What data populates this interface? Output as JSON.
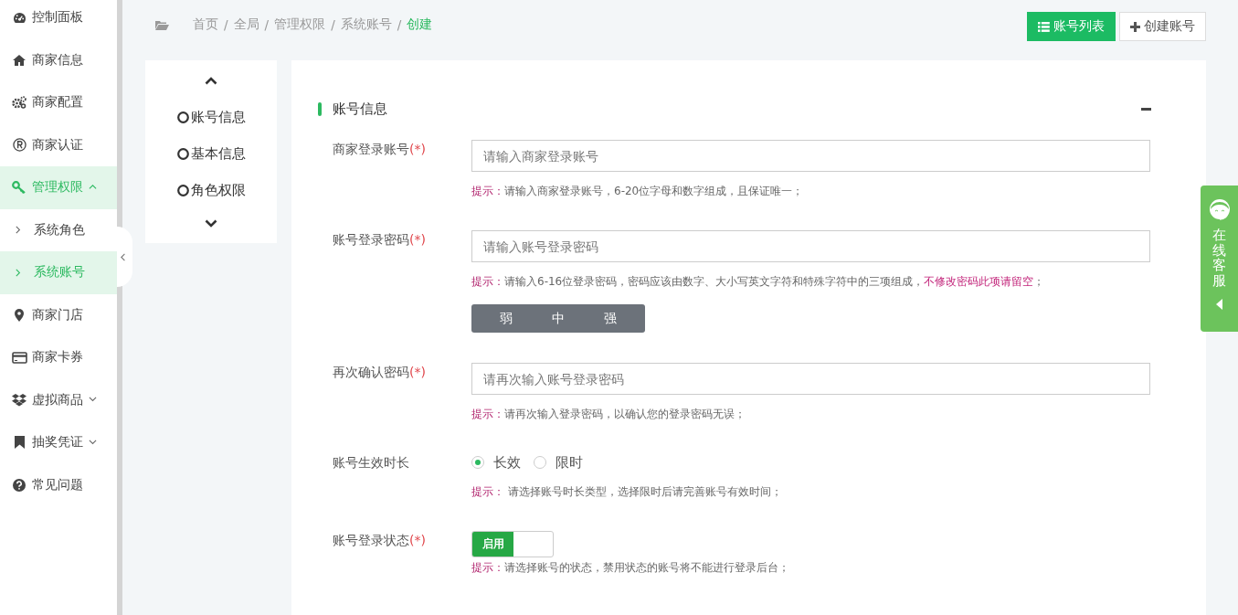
{
  "sidebar": {
    "items": [
      {
        "label": "控制面板",
        "selected": false
      },
      {
        "label": "商家信息",
        "selected": false
      },
      {
        "label": "商家配置",
        "selected": false
      },
      {
        "label": "商家认证",
        "selected": false
      },
      {
        "label": "管理权限",
        "selected": true,
        "expanded": true,
        "children": [
          {
            "label": "系统角色",
            "selected": false
          },
          {
            "label": "系统账号",
            "selected": true
          }
        ]
      },
      {
        "label": "商家门店",
        "selected": false
      },
      {
        "label": "商家卡券",
        "selected": false
      },
      {
        "label": "虚拟商品",
        "selected": false,
        "expanded": false
      },
      {
        "label": "抽奖凭证",
        "selected": false,
        "expanded": false
      },
      {
        "label": "常见问题",
        "selected": false
      }
    ]
  },
  "breadcrumb": [
    {
      "label": "首页",
      "current": false
    },
    {
      "separator": "/",
      "label": "全局",
      "current": false
    },
    {
      "separator": "/",
      "label": "管理权限",
      "current": false
    },
    {
      "separator": "/",
      "label": "系统账号",
      "current": false
    },
    {
      "separator": "/",
      "label": "创建",
      "current": true
    }
  ],
  "toolbar": {
    "buttons": [
      {
        "label": "账号列表",
        "primary": true
      },
      {
        "label": "创建账号",
        "primary": false
      }
    ]
  },
  "step_nav": {
    "items": [
      {
        "label": "账号信息",
        "selected": false
      },
      {
        "label": "基本信息",
        "selected": false
      },
      {
        "label": "角色权限",
        "selected": false
      }
    ]
  },
  "form": {
    "section_title": "账号信息",
    "collapsed": false,
    "fields": [
      {
        "kind": "input",
        "label": "商家登录账号",
        "required": "(*)",
        "placeholder": "请输入商家登录账号",
        "hint": [
          {
            "kind": "label",
            "text": "提示："
          },
          {
            "kind": "plain",
            "text": "请输入商家登录账号，6-20位字母和数字组成，且保证唯一；"
          }
        ]
      },
      {
        "kind": "input",
        "label": "账号登录密码",
        "required": "(*)",
        "placeholder": "请输入账号登录密码",
        "hint": [
          {
            "kind": "label",
            "text": "提示："
          },
          {
            "kind": "plain",
            "text": "请输入6-16位登录密码，密码应该由数字、大小写英文字符和特殊字符中的三项组成，"
          },
          {
            "kind": "warning",
            "text": "不修改密码此项请留空"
          },
          {
            "kind": "plain",
            "text": "；"
          }
        ],
        "strength": [
          "弱",
          "中",
          "强"
        ]
      },
      {
        "kind": "input",
        "label": "再次确认密码",
        "required": "(*)",
        "placeholder": "请再次输入账号登录密码",
        "hint": [
          {
            "kind": "label",
            "text": "提示："
          },
          {
            "kind": "plain",
            "text": "请再次输入登录密码，以确认您的登录密码无误；"
          }
        ]
      },
      {
        "kind": "radio",
        "label": "账号生效时长",
        "options": [
          {
            "label": "长效",
            "selected": true
          },
          {
            "label": "限时",
            "selected": false
          }
        ],
        "hint": [
          {
            "kind": "label",
            "text": "提示："
          },
          {
            "kind": "plain",
            "text": " 请选择账号时长类型，选择限时后请完善账号有效时间；"
          }
        ]
      },
      {
        "kind": "toggle",
        "label": "账号登录状态",
        "required": "(*)",
        "on": true,
        "on_label": "启用",
        "hint": [
          {
            "kind": "label",
            "text": "提示："
          },
          {
            "kind": "plain",
            "text": "请选择账号的状态，禁用状态的账号将不能进行登录后台；"
          }
        ]
      }
    ]
  },
  "service_tab": {
    "label": "在线客服"
  }
}
